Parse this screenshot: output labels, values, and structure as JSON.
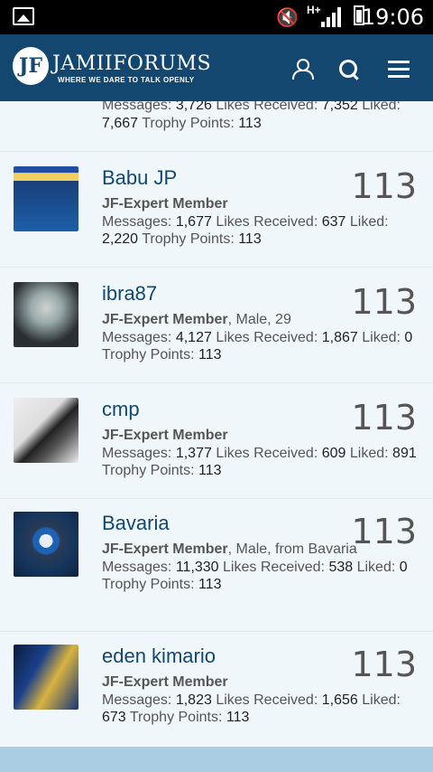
{
  "status_bar": {
    "time": "19:06",
    "network": "H+"
  },
  "header": {
    "logo_mark": "JF",
    "brand": "JAMIIFORUMS",
    "tagline": "WHERE WE DARE TO TALK OPENLY"
  },
  "labels": {
    "messages": "Messages:",
    "likes_received": "Likes Received:",
    "liked": "Liked:",
    "trophy_points": "Trophy Points:"
  },
  "top_partial": {
    "messages": "3,726",
    "likes_received": "7,352",
    "liked": "7,667",
    "trophy_points": "113"
  },
  "members": [
    {
      "name": "Babu JP",
      "title": "JF-Expert Member",
      "extra": "",
      "messages": "1,677",
      "likes_received": "637",
      "liked": "2,220",
      "trophy_points": "113",
      "score": "113"
    },
    {
      "name": "ibra87",
      "title": "JF-Expert Member",
      "extra": ", Male, 29",
      "messages": "4,127",
      "likes_received": "1,867",
      "liked": "0",
      "trophy_points": "113",
      "score": "113"
    },
    {
      "name": "cmp",
      "title": "JF-Expert Member",
      "extra": "",
      "messages": "1,377",
      "likes_received": "609",
      "liked": "891",
      "trophy_points": "113",
      "score": "113"
    },
    {
      "name": "Bavaria",
      "title": "JF-Expert Member",
      "extra": ", Male, from Bavaria",
      "messages": "11,330",
      "likes_received": "538",
      "liked": "0",
      "trophy_points": "113",
      "score": "113"
    },
    {
      "name": "eden kimario",
      "title": "JF-Expert Member",
      "extra": "",
      "messages": "1,823",
      "likes_received": "1,656",
      "liked": "673",
      "trophy_points": "113",
      "score": "113"
    }
  ]
}
